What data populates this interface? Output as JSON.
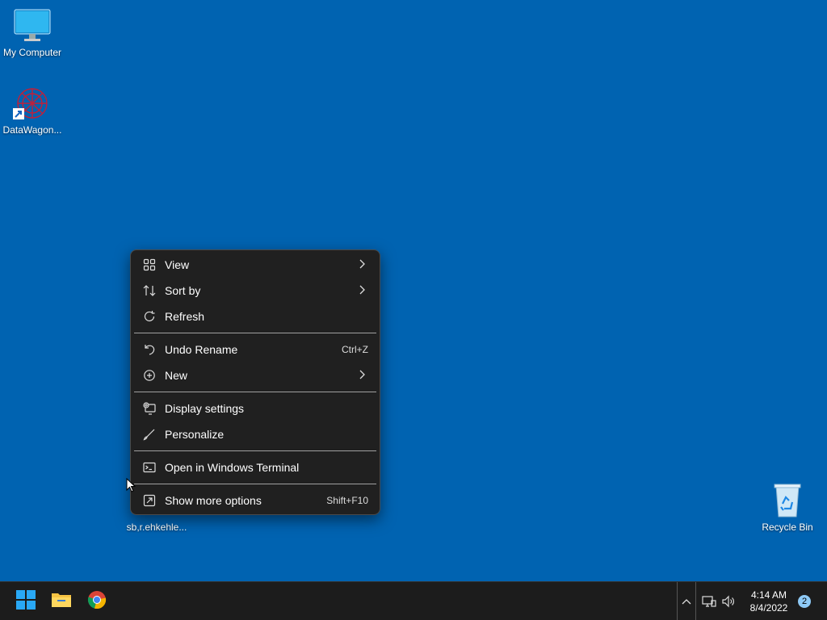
{
  "desktop": {
    "icons": [
      {
        "label": "My Computer"
      },
      {
        "label": "DataWagon..."
      },
      {
        "label": "sb,r.ehkehle..."
      },
      {
        "label": "Recycle Bin"
      }
    ]
  },
  "context_menu": {
    "items": [
      {
        "label": "View",
        "icon": "grid-icon",
        "has_submenu": true
      },
      {
        "label": "Sort by",
        "icon": "sort-icon",
        "has_submenu": true
      },
      {
        "label": "Refresh",
        "icon": "refresh-icon"
      },
      {
        "label": "Undo Rename",
        "icon": "undo-icon",
        "shortcut": "Ctrl+Z"
      },
      {
        "label": "New",
        "icon": "new-plus-icon",
        "has_submenu": true
      },
      {
        "label": "Display settings",
        "icon": "display-settings-icon"
      },
      {
        "label": "Personalize",
        "icon": "brush-icon"
      },
      {
        "label": "Open in Windows Terminal",
        "icon": "terminal-icon"
      },
      {
        "label": "Show more options",
        "icon": "show-more-icon",
        "shortcut": "Shift+F10"
      }
    ]
  },
  "taskbar": {
    "pinned": [
      {
        "name": "start",
        "icon": "windows-logo-icon"
      },
      {
        "name": "file-explorer",
        "icon": "folder-icon"
      },
      {
        "name": "chrome",
        "icon": "chrome-icon"
      }
    ],
    "tray": {
      "time": "4:14 AM",
      "date": "8/4/2022",
      "notification_count": "2"
    }
  },
  "colors": {
    "desktop_bg": "#0063b1",
    "menu_bg": "#202020",
    "taskbar_bg": "#1c1c1c",
    "badge": "#8ec9f5"
  }
}
